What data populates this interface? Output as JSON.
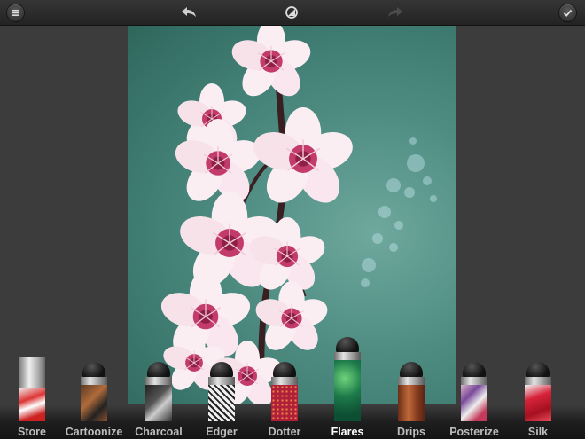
{
  "toolbar": {
    "menu_icon": "menu-icon",
    "undo_icon": "undo-arrow-icon",
    "compare_icon": "compare-icon",
    "redo_icon": "redo-arrow-icon",
    "done_icon": "checkmark-icon"
  },
  "photo": {
    "subject": "cherry-blossom-photo"
  },
  "filters": [
    {
      "label": "Store",
      "active": false
    },
    {
      "label": "Cartoonize",
      "active": false
    },
    {
      "label": "Charcoal",
      "active": false
    },
    {
      "label": "Edger",
      "active": false
    },
    {
      "label": "Dotter",
      "active": false
    },
    {
      "label": "Flares",
      "active": true
    },
    {
      "label": "Drips",
      "active": false
    },
    {
      "label": "Posterize",
      "active": false
    },
    {
      "label": "Silk",
      "active": false
    }
  ],
  "colors": {
    "active_label": "#ffffff",
    "inactive_label": "#bdbdbd",
    "background": "#3a3a3a"
  }
}
